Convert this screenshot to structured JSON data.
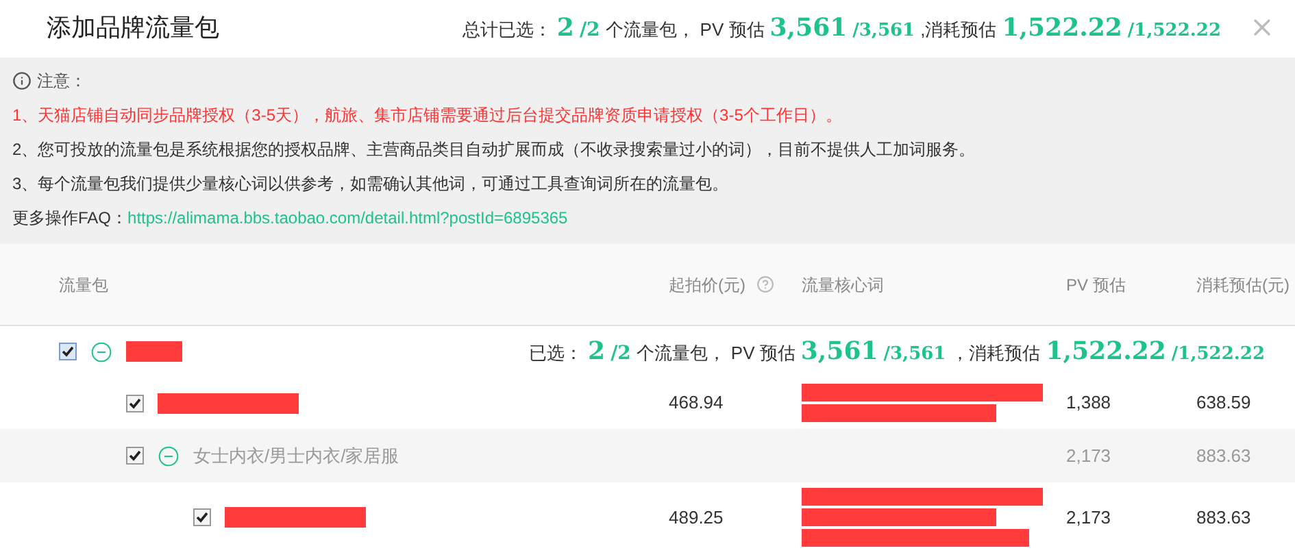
{
  "title": "添加品牌流量包",
  "summary": {
    "label": "总计已选：",
    "selected": "2",
    "total": "/2",
    "unit": "个流量包，",
    "pv_label": "PV 预估",
    "pv": "3,561",
    "pv_total": "/3,561",
    "cost_label": ",消耗预估",
    "cost": "1,522.22",
    "cost_total": "/1,522.22"
  },
  "notice": {
    "title": "注意：",
    "lines": [
      {
        "text": "1、天猫店铺自动同步品牌授权（3-5天），航旅、集市店铺需要通过后台提交品牌资质申请授权（3-5个工作日）。",
        "kind": "warning"
      },
      {
        "text": "2、您可投放的流量包是系统根据您的授权品牌、主营商品类目自动扩展而成（不收录搜索量过小的词），目前不提供人工加词服务。",
        "kind": "normal"
      },
      {
        "text": "3、每个流量包我们提供少量核心词以供参考，如需确认其他词，可通过工具查询词所在的流量包。",
        "kind": "normal"
      }
    ],
    "faq_label": "更多操作FAQ：",
    "faq_link": "https://alimama.bbs.taobao.com/detail.html?postId=6895365"
  },
  "columns": [
    "流量包",
    "起拍价(元)",
    "流量核心词",
    "PV 预估",
    "消耗预估(元)"
  ],
  "rows": [
    {
      "kind": "group",
      "checked": true,
      "expanded": true,
      "name_redacted": true,
      "summary": {
        "label": "已选：",
        "selected": "2",
        "total": "/2",
        "unit": "个流量包，",
        "pv_label": "PV 预估",
        "pv": "3,561",
        "pv_total": "/3,561",
        "cost_label": "，消耗预估",
        "cost": "1,522.22",
        "cost_total": "/1,522.22"
      },
      "children": [
        {
          "kind": "item",
          "checked": true,
          "name_redacted": true,
          "price": "468.94",
          "keywords": [
            {
              "redacted": true
            },
            {
              "redacted": true
            }
          ],
          "pv": "1,388",
          "cost": "638.59"
        },
        {
          "kind": "subgroup",
          "checked": true,
          "expanded": true,
          "name": "女士内衣/男士内衣/家居服",
          "pv": "2,173",
          "cost": "883.63",
          "children": [
            {
              "kind": "item",
              "checked": true,
              "name_redacted": true,
              "price": "489.25",
              "keywords": [
                {
                  "redacted": true
                },
                {
                  "redacted": true
                },
                {
                  "redacted": true
                }
              ],
              "pv": "2,173",
              "cost": "883.63"
            }
          ]
        }
      ]
    }
  ]
}
